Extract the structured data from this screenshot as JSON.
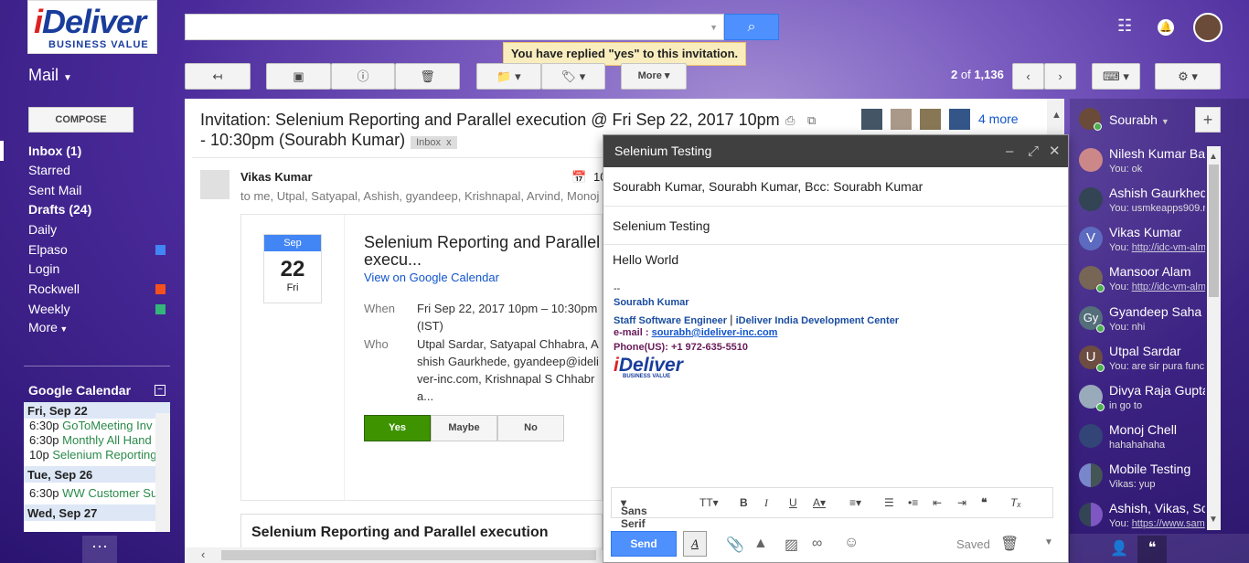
{
  "logo": {
    "main": "Deliver",
    "i": "i",
    "sub": "BUSINESS VALUE"
  },
  "notice": "You have replied \"yes\" to this invitation.",
  "mail_label": "Mail",
  "toolbar": {
    "more": "More"
  },
  "pager": {
    "range": "2",
    "of": "of",
    "total": "1,136"
  },
  "compose_label": "COMPOSE",
  "nav": [
    {
      "label": "Inbox (1)",
      "bold": true
    },
    {
      "label": "Starred"
    },
    {
      "label": "Sent Mail"
    },
    {
      "label": "Drafts (24)",
      "bold": true
    },
    {
      "label": "Daily"
    },
    {
      "label": "Elpaso",
      "color": "#4285f4"
    },
    {
      "label": "Login"
    },
    {
      "label": "Rockwell",
      "color": "#f4511e"
    },
    {
      "label": "Weekly",
      "color": "#33b679"
    },
    {
      "label": "More"
    }
  ],
  "gcal": {
    "title": "Google Calendar",
    "days": [
      {
        "day": "Fri, Sep 22",
        "events": [
          {
            "time": "6:30p",
            "title": "GoToMeeting Inv"
          },
          {
            "time": "6:30p",
            "title": "Monthly All Hand"
          },
          {
            "time": "10p",
            "title": "Selenium Reporting"
          }
        ]
      },
      {
        "day": "Tue, Sep 26",
        "events": [
          {
            "time": "6:30p",
            "title": "WW Customer Su"
          }
        ]
      },
      {
        "day": "Wed, Sep 27",
        "events": []
      }
    ]
  },
  "email": {
    "subject": "Invitation: Selenium Reporting and Parallel execution @ Fri Sep 22, 2017 10pm - 10:30pm (Sourabh Kumar)",
    "tag": "Inbox",
    "tag_x": "x",
    "more_people": "4 more",
    "sender": "Vikas Kumar",
    "recipients": "to me, Utpal, Satyapal, Ashish, gyandeep, Krishnapal, Arvind, Monoj",
    "date_short": "10"
  },
  "event": {
    "month": "Sep",
    "day": "22",
    "weekday": "Fri",
    "title": "Selenium Reporting and Parallel execu...",
    "link": "View on Google Calendar",
    "when_label": "When",
    "when": "Fri Sep 22, 2017 10pm – 10:30pm (IST)",
    "who_label": "Who",
    "who": "Utpal Sardar, Satyapal Chhabra, Ashish Gaurkhede, gyandeep@ideliver-inc.com, Krishnapal S Chhabra...",
    "rsvp": [
      "Yes",
      "Maybe",
      "No"
    ],
    "footer_title": "Selenium Reporting and Parallel execution"
  },
  "compose": {
    "title": "Selenium Testing",
    "to": "Sourabh Kumar, Sourabh Kumar, Bcc: Sourabh Kumar",
    "subject": "Selenium Testing",
    "body": "Hello World",
    "sig_dash": "--",
    "sig_name": "Sourabh Kumar",
    "sig_role": "Staff Software Engineer",
    "sig_sep": "|",
    "sig_org": "iDeliver India Development Center",
    "sig_email_label": "e-mail :",
    "sig_email": "sourabh@ideliver-inc.com",
    "sig_phone": "Phone(US):   +1 972-635-5510",
    "font": "Sans Serif",
    "send": "Send",
    "saved": "Saved"
  },
  "chat": {
    "me": "Sourabh",
    "contacts": [
      {
        "name": "Nilesh Kumar Ban",
        "msg": "You: ok"
      },
      {
        "name": "Ashish Gaurkhede",
        "msg": "You: usmkeapps909.n"
      },
      {
        "name": "Vikas Kumar",
        "msg": "You: ",
        "link": "http://idc-vm-alm",
        "initial": "V"
      },
      {
        "name": "Mansoor Alam",
        "msg": "You: ",
        "link": "http://idc-vm-alm"
      },
      {
        "name": "Gyandeep Saha",
        "msg": "You: nhi",
        "initial": "Gy"
      },
      {
        "name": "Utpal Sardar",
        "msg": "You: are sir pura func",
        "initial": "U"
      },
      {
        "name": "Divya Raja Gupta",
        "msg": "in go to"
      },
      {
        "name": "Monoj Chell",
        "msg": "hahahahaha"
      },
      {
        "name": "Mobile Testing",
        "msg": "Vikas: yup"
      },
      {
        "name": "Ashish, Vikas, Sou",
        "msg": "You: ",
        "link": "https://www.sam"
      }
    ]
  },
  "colors": {
    "accent": "#4d90fe",
    "yes": "#3d9400"
  }
}
